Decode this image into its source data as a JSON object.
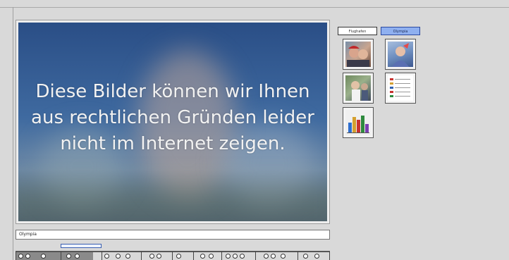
{
  "video": {
    "message_lines": [
      "Diese Bilder können wir Ihnen",
      "aus rechtlichen Gründen leider",
      "nicht im Internet zeigen."
    ]
  },
  "tabs": [
    {
      "label": "Flughafen",
      "active": false
    },
    {
      "label": "Olympia",
      "active": true
    }
  ],
  "thumbnails": [
    {
      "name": "thumbnail-1",
      "icon": "photo-icon"
    },
    {
      "name": "thumbnail-2",
      "icon": "photo-icon"
    },
    {
      "name": "thumbnail-3",
      "icon": "photo-icon"
    },
    {
      "name": "thumbnail-4",
      "icon": "table-icon"
    },
    {
      "name": "thumbnail-5",
      "icon": "bar-chart-icon"
    }
  ],
  "caption": {
    "value": "Olympia"
  },
  "colors": {
    "background": "#d9d9d9",
    "active_tab": "#8fb0f0",
    "video_top": "#2a4e86"
  }
}
